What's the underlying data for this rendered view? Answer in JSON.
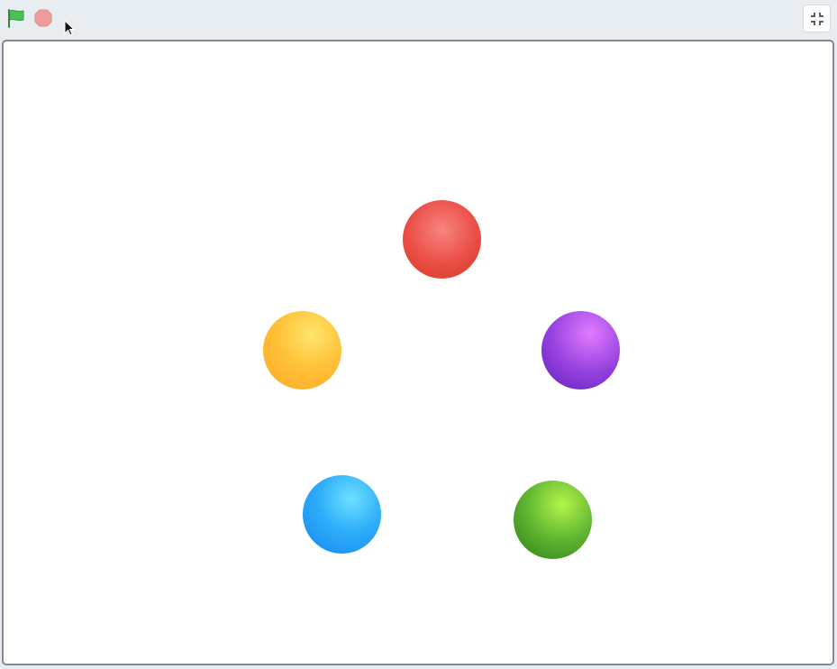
{
  "toolbar": {
    "green_flag_icon": "green-flag-icon",
    "stop_icon": "stop-icon",
    "fullscreen_icon": "unfullscreen-icon"
  },
  "colors": {
    "toolbar_bg": "#e8edf2",
    "stage_bg": "#ffffff",
    "stage_border": "#858a91",
    "flag_green": "#4cbf56",
    "stop_red": "#ec9c9c"
  },
  "stage": {
    "sprites": [
      {
        "name": "red-ball",
        "color": "#ea4e45"
      },
      {
        "name": "orange-ball",
        "color": "#ffc23a"
      },
      {
        "name": "purple-ball",
        "color": "#9a44e0"
      },
      {
        "name": "blue-ball",
        "color": "#2eaef9"
      },
      {
        "name": "green-ball",
        "color": "#5fb431"
      }
    ]
  }
}
